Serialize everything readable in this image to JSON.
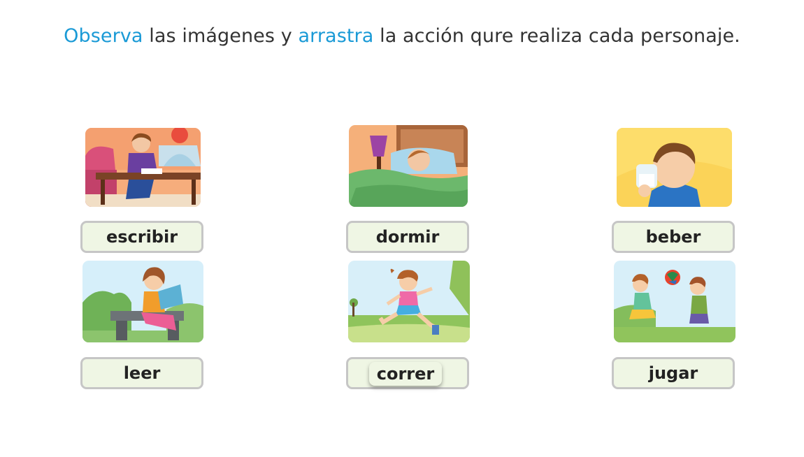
{
  "instruction": {
    "part1": "Observa",
    "part2": " las imágenes y ",
    "part3": "arrastra",
    "part4": " la acción qure realiza cada personaje."
  },
  "cards": [
    {
      "word": "escribir",
      "image": "boy-writing-at-table"
    },
    {
      "word": "dormir",
      "image": "child-sleeping-in-bed"
    },
    {
      "word": "beber",
      "image": "boy-drinking-milk"
    },
    {
      "word": "leer",
      "image": "girl-reading-on-bench"
    },
    {
      "word": "correr",
      "image": "girl-running-in-park",
      "dragged": true
    },
    {
      "word": "jugar",
      "image": "girls-playing-ball"
    }
  ],
  "colors": {
    "accent": "#1a9ad6",
    "drop_bg": "#eff6e4",
    "drop_border": "#c6c6c6"
  }
}
